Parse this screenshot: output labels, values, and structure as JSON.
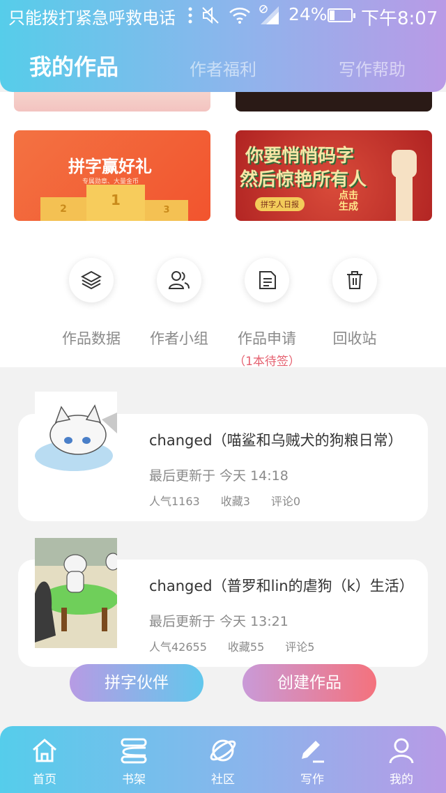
{
  "status_bar": {
    "carrier": "只能拨打紧急呼救电话",
    "battery_percent": "24%",
    "battery_level": 0.24,
    "time": "下午8:07"
  },
  "tabs": [
    {
      "label": "我的作品",
      "active": true
    },
    {
      "label": "作者福利",
      "active": false
    },
    {
      "label": "写作帮助",
      "active": false
    }
  ],
  "banners": {
    "pinzi": {
      "title": "拼字赢好礼",
      "subtitle": "专属勋章、大量金币",
      "podium": [
        "2",
        "1",
        "3"
      ]
    },
    "qiaoqiao": {
      "line1": "你要悄悄码字",
      "line2": "然后惊艳所有人",
      "tag": "拼字人日报",
      "cta": "点击生成"
    }
  },
  "quick_actions": [
    {
      "label": "作品数据",
      "icon": "layers-icon"
    },
    {
      "label": "作者小组",
      "icon": "group-icon"
    },
    {
      "label": "作品申请",
      "icon": "document-icon",
      "note": "（1本待签）"
    },
    {
      "label": "回收站",
      "icon": "trash-icon"
    }
  ],
  "works": [
    {
      "title": "changed（喵鲨和乌贼犬的狗粮日常）",
      "updated": "最后更新于 今天 14:18",
      "stats": [
        "人气1163",
        "收藏3",
        "评论0"
      ]
    },
    {
      "title": "changed（普罗和lin的虐狗（k）生活）",
      "updated": "最后更新于 今天 13:21",
      "stats": [
        "人气42655",
        "收藏55",
        "评论5"
      ]
    }
  ],
  "buttons": {
    "partner": "拼字伙伴",
    "create": "创建作品"
  },
  "bottom_nav": [
    {
      "label": "首页",
      "icon": "home-icon"
    },
    {
      "label": "书架",
      "icon": "bookshelf-icon"
    },
    {
      "label": "社区",
      "icon": "planet-icon"
    },
    {
      "label": "写作",
      "icon": "pen-icon",
      "active": true
    },
    {
      "label": "我的",
      "icon": "user-icon"
    }
  ],
  "colors": {
    "accent_start": "#56cdea",
    "accent_end": "#b99ae6",
    "pending_note": "#e5606f"
  }
}
